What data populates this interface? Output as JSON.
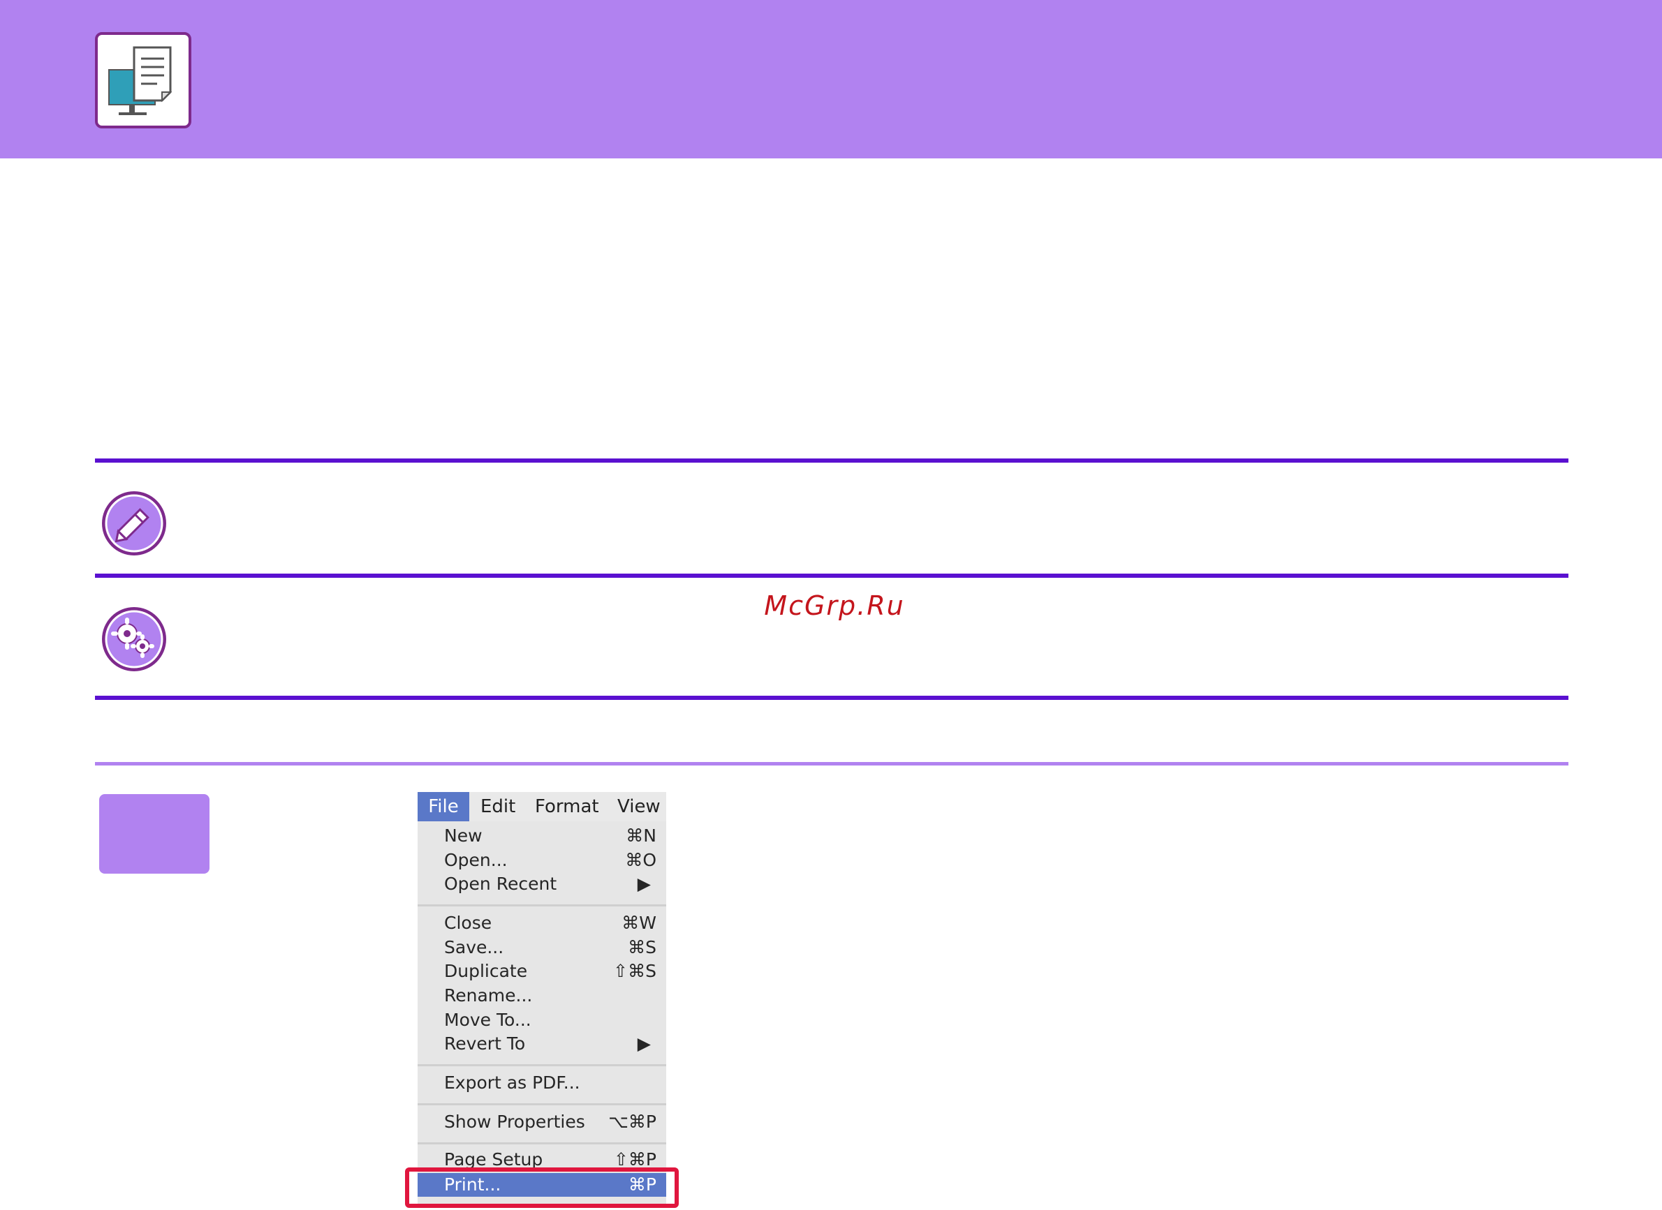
{
  "watermark": "McGrp.Ru",
  "colors": {
    "header": "#b182f0",
    "rule_dark": "#5a10d0",
    "badge": "#9b5ccf",
    "print_frame": "#e0163e",
    "menu_highlight": "#5a78c8"
  },
  "icons": {
    "header_logo": "printer-computer-icon",
    "note": "pencil-icon",
    "settings": "gears-icon"
  },
  "menu": {
    "menubar": [
      {
        "label": "File",
        "active": true
      },
      {
        "label": "Edit",
        "active": false
      },
      {
        "label": "Format",
        "active": false
      },
      {
        "label": "View",
        "active": false
      }
    ],
    "items": [
      {
        "label": "New",
        "shortcut": "⌘N"
      },
      {
        "label": "Open...",
        "shortcut": "⌘O"
      },
      {
        "label": "Open Recent",
        "shortcut": "▶"
      },
      {
        "label": "Close",
        "shortcut": "⌘W"
      },
      {
        "label": "Save...",
        "shortcut": "⌘S"
      },
      {
        "label": "Duplicate",
        "shortcut": "⇧⌘S"
      },
      {
        "label": "Rename...",
        "shortcut": ""
      },
      {
        "label": "Move To...",
        "shortcut": ""
      },
      {
        "label": "Revert To",
        "shortcut": "▶"
      },
      {
        "label": "Export as PDF...",
        "shortcut": ""
      },
      {
        "label": "Show Properties",
        "shortcut": "⌥⌘P"
      },
      {
        "label": "Page Setup",
        "shortcut": "⇧⌘P"
      },
      {
        "label": "Print...",
        "shortcut": "⌘P"
      }
    ]
  }
}
